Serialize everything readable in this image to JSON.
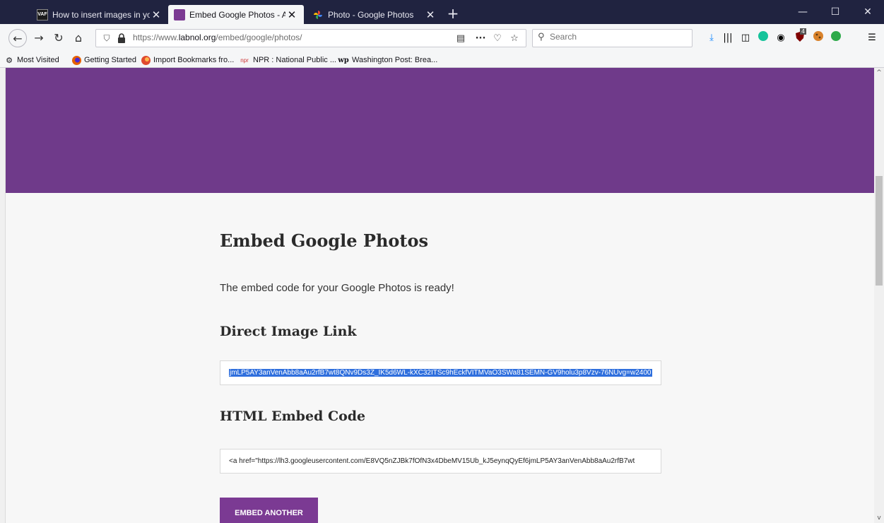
{
  "browser": {
    "tabs": [
      {
        "title": "How to insert images in your p",
        "favicon": "vaf-icon",
        "favicon_text": "VAF",
        "active": false
      },
      {
        "title": "Embed Google Photos - Add Im",
        "favicon": "labnol-icon",
        "active": true
      },
      {
        "title": "Photo - Google Photos",
        "favicon": "google-photos-icon",
        "active": false
      }
    ],
    "new_tab_label": "+",
    "url": {
      "scheme_prefix": "https://www.",
      "domain": "labnol.org",
      "path": "/embed/google/photos/"
    },
    "search_placeholder": "Search",
    "bookmarks": [
      {
        "label": "Most Visited",
        "icon": "gear-icon"
      },
      {
        "label": "Getting Started",
        "icon": "firefox-icon"
      },
      {
        "label": "Import Bookmarks fro...",
        "icon": "import-icon"
      },
      {
        "label": "NPR : National Public ...",
        "icon": "npr-icon",
        "icon_text": "npr"
      },
      {
        "label": "Washington Post: Brea...",
        "icon": "wp-icon",
        "icon_text": "wp"
      }
    ],
    "toolbar_badge": "4"
  },
  "page": {
    "heading": "Embed Google Photos",
    "lead": "The embed code for your Google Photos is ready!",
    "direct_link_heading": "Direct Image Link",
    "direct_link_value": "jmLP5AY3anVenAbb8aAu2rfB7wt8QNv9Ds3Z_IK5d6WL-kXC32ITSc9hEckfVITMVaO3SWa81SEMN-GV9holu3p8Vzv-76NUvg=w2400",
    "embed_heading": "HTML Embed Code",
    "embed_value": "<a href=\"https://lh3.googleusercontent.com/E8VQ5nZJBk7fOfN3x4DbeMV15Ub_kJ5eynqQyEf6jmLP5AY3anVenAbb8aAu2rfB7wt",
    "button_label": "EMBED ANOTHER"
  },
  "colors": {
    "hero": "#6f3a8a",
    "button": "#7b3a93",
    "selection": "#2f6fdd",
    "tabbar": "#202340"
  }
}
